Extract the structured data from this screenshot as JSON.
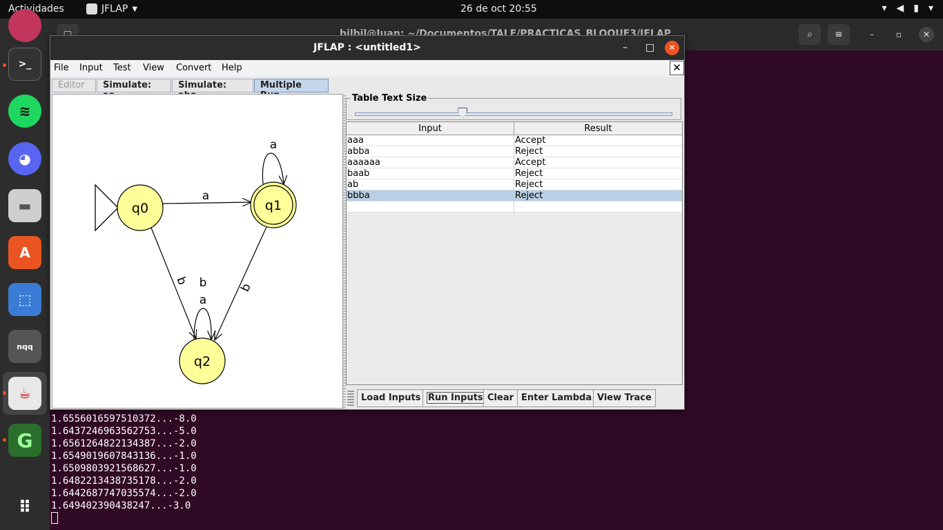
{
  "topbar": {
    "activities": "Actividades",
    "app_name": "JFLAP",
    "clock": "26 de oct  20:55"
  },
  "terminal": {
    "title": "bilbil@Juan: ~/Documentos/TALF/PRACTICAS_BLOQUE3/JFLAP",
    "lines": [
      "1.6556016597510372...-8.0",
      "1.6437246963562753...-5.0",
      "1.6561264822134387...-2.0",
      "1.6549019607843136...-1.0",
      "1.6509803921568627...-1.0",
      "1.6482213438735178...-2.0",
      "1.6442687747035574...-2.0",
      "1.649402390438247...-3.0"
    ]
  },
  "jflap": {
    "title": "JFLAP : <untitled1>",
    "menu": [
      "File",
      "Input",
      "Test",
      "View",
      "Convert",
      "Help"
    ],
    "tabs": [
      "Editor",
      "Simulate: aa",
      "Simulate: aba",
      "Multiple Run"
    ],
    "active_tab": "Multiple Run",
    "automaton": {
      "states": [
        "q0",
        "q1",
        "q2"
      ],
      "initial": "q0",
      "final": [
        "q1"
      ],
      "transitions": [
        {
          "from": "q0",
          "to": "q1",
          "label": "a"
        },
        {
          "from": "q1",
          "to": "q1",
          "label": "a"
        },
        {
          "from": "q0",
          "to": "q2",
          "label": "b"
        },
        {
          "from": "q1",
          "to": "q2",
          "label": "b"
        },
        {
          "from": "q2",
          "to": "q2",
          "label_top": "b",
          "label_bottom": "a"
        }
      ]
    },
    "table_text_size_label": "Table Text Size",
    "table_text_size_level": 0.34,
    "columns": [
      "Input",
      "Result"
    ],
    "rows": [
      {
        "input": "aaa",
        "result": "Accept"
      },
      {
        "input": "abba",
        "result": "Reject"
      },
      {
        "input": "aaaaaa",
        "result": "Accept"
      },
      {
        "input": "baab",
        "result": "Reject"
      },
      {
        "input": "ab",
        "result": "Reject"
      },
      {
        "input": "bbba",
        "result": "Reject"
      },
      {
        "input": "",
        "result": ""
      }
    ],
    "selected_row": 5,
    "buttons": [
      "Load Inputs",
      "Run Inputs",
      "Clear",
      "Enter Lambda",
      "View Trace"
    ]
  },
  "colors": {
    "state_fill": "#ffff99",
    "terminal_bg": "#300a24",
    "accent": "#e95420",
    "selection": "#b8cfe5"
  }
}
